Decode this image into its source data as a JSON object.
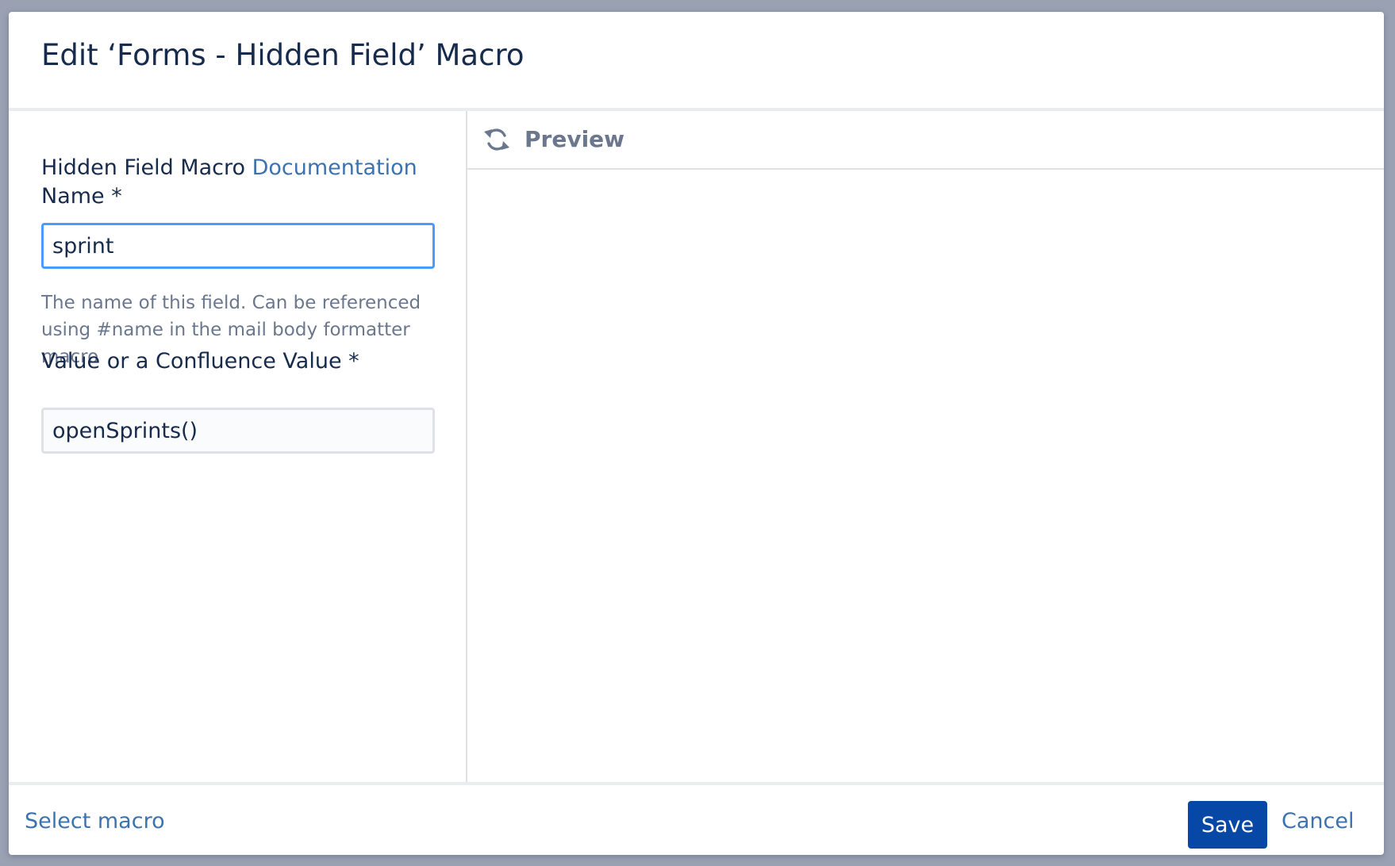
{
  "dialog": {
    "title": "Edit ‘Forms - Hidden Field’ Macro"
  },
  "form": {
    "doc_prefix": "Hidden Field Macro ",
    "doc_link": "Documentation",
    "name_label": "Name *",
    "name_value": "sprint",
    "name_help": "The name of this field. Can be referenced using #name in the mail body formatter macro",
    "value_label": "Value or a Confluence Value *",
    "value_value": "openSprints()"
  },
  "preview": {
    "title": "Preview",
    "icon": "refresh-icon"
  },
  "footer": {
    "select_macro": "Select macro",
    "save": "Save",
    "cancel": "Cancel"
  },
  "colors": {
    "link": "#3b73af",
    "primary_button": "#0747a6",
    "focus_border": "#4c9aff",
    "text": "#172b4d",
    "muted_text": "#6b778c",
    "overlay": "#9aa1b2"
  }
}
